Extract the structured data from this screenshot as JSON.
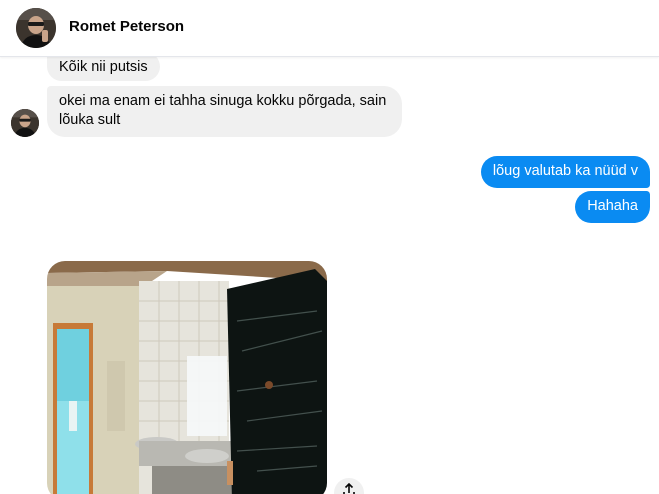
{
  "conversation": {
    "contact_name": "Romet Peterson"
  },
  "messages": [
    {
      "from": "contact",
      "text": "Kõik nii putsis"
    },
    {
      "from": "contact",
      "text": "okei ma enam ei tahha sinuga kokku põrgada, sain lõuka sult"
    },
    {
      "from": "me",
      "text": "lõug valutab ka nüüd v"
    },
    {
      "from": "me",
      "text": "Hahaha"
    },
    {
      "from": "contact",
      "type": "photo"
    }
  ],
  "colors": {
    "outgoing_bubble": "#0a8bf2",
    "incoming_bubble": "#f0f0f0"
  },
  "icons": {
    "share": "share-icon"
  }
}
